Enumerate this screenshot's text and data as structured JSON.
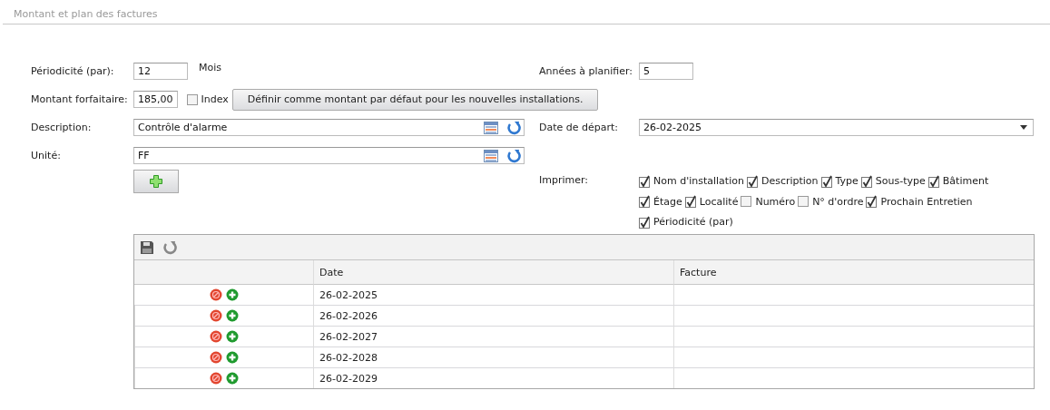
{
  "section_title": "Montant et plan des factures",
  "periodicity": {
    "label": "Périodicité (par):",
    "value": "12",
    "unit": "Mois"
  },
  "years": {
    "label": "Années à planifier:",
    "value": "5"
  },
  "amount": {
    "label": "Montant forfaitaire:",
    "value": "185,00",
    "index": {
      "label": "Index",
      "checked": false
    },
    "default_button": "Définir comme montant par défaut pour les nouvelles installations."
  },
  "description": {
    "label": "Description:",
    "value": "Contrôle d'alarme"
  },
  "start_date": {
    "label": "Date de départ:",
    "value": "26-02-2025"
  },
  "unit": {
    "label": "Unité:",
    "value": "FF"
  },
  "print": {
    "label": "Imprimer:",
    "options": [
      {
        "label": "Nom d'installation",
        "checked": true
      },
      {
        "label": "Description",
        "checked": true
      },
      {
        "label": "Type",
        "checked": true
      },
      {
        "label": "Sous-type",
        "checked": true
      },
      {
        "label": "Bâtiment",
        "checked": true
      },
      {
        "label": "Étage",
        "checked": true
      },
      {
        "label": "Localité",
        "checked": true
      },
      {
        "label": "Numéro",
        "checked": false
      },
      {
        "label": "N° d'ordre",
        "checked": false
      },
      {
        "label": "Prochain Entretien",
        "checked": true
      },
      {
        "label": "Périodicité (par)",
        "checked": true
      }
    ]
  },
  "table": {
    "columns": [
      {
        "label": "Date"
      },
      {
        "label": "Facture"
      }
    ],
    "rows": [
      {
        "date": "26-02-2025"
      },
      {
        "date": "26-02-2026"
      },
      {
        "date": "26-02-2027"
      },
      {
        "date": "26-02-2028"
      },
      {
        "date": "26-02-2029"
      }
    ]
  }
}
